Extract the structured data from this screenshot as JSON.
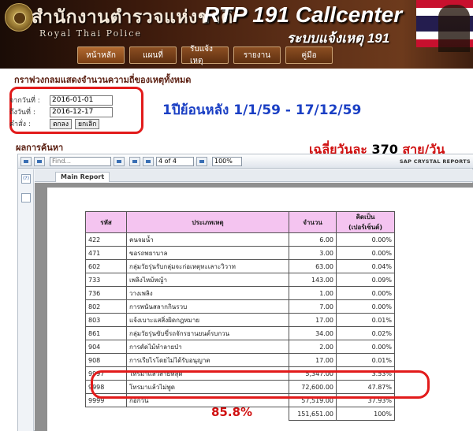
{
  "header": {
    "org_thai": "สำนักงานตำรวจแห่งชาติ",
    "org_english": "Royal Thai Police",
    "app_title": "RTP 191 Callcenter",
    "app_subtitle": "ระบบแจ้งเหตุ 191",
    "nav": [
      {
        "label": "หน้าหลัก",
        "active": true
      },
      {
        "label": "แผนที่",
        "active": false
      },
      {
        "label": "รับแจ้งเหตุ",
        "active": false
      },
      {
        "label": "รายงาน",
        "active": false
      },
      {
        "label": "คู่มือ",
        "active": false
      }
    ]
  },
  "filter": {
    "section_title": "กราฟวงกลมแสดงจำนวนความถี่ของเหตุทั้งหมด",
    "from_label": "จากวันที่ :",
    "from_value": "2016-01-01",
    "to_label": "ถึงวันที่ :",
    "to_value": "2016-12-17",
    "command_label": "คำสั่ง :",
    "ok_label": "ตกลง",
    "cancel_label": "ยกเลิก"
  },
  "annotations": {
    "range_text": "1ปีย้อนหลัง   1/1/59 - 17/12/59",
    "avg_prefix": "เฉลี่ยวันละ ",
    "avg_number": "370",
    "avg_suffix": " สาย/วัน",
    "share_text": "85.8%"
  },
  "results": {
    "title": "ผลการค้นหา"
  },
  "viewer": {
    "find_placeholder": "Find...",
    "page_value": "4 of 4",
    "zoom_value": "100%",
    "brand": "SAP CRYSTAL REPORTS",
    "report_tab": "Main Report",
    "side_buttons": [
      "(?)",
      "tree"
    ]
  },
  "table": {
    "headers": [
      "รหัส",
      "ประเภทเหตุ",
      "จำนวน",
      "คิดเป็น (เปอร์เซ็นต์)"
    ],
    "rows": [
      {
        "code": "422",
        "type": "คนจมน้ำ",
        "count": "6.00",
        "pct": "0.00%"
      },
      {
        "code": "471",
        "type": "ขอรถพยาบาล",
        "count": "3.00",
        "pct": "0.00%"
      },
      {
        "code": "602",
        "type": "กลุ่มวัยรุ่นรับกลุ่มจะก่อเหตุทะเลาะวิวาท",
        "count": "63.00",
        "pct": "0.04%"
      },
      {
        "code": "733",
        "type": "เพลิงไหม้หญ้า",
        "count": "143.00",
        "pct": "0.09%"
      },
      {
        "code": "736",
        "type": "วางเพลิง",
        "count": "1.00",
        "pct": "0.00%"
      },
      {
        "code": "802",
        "type": "การพนันสลากกินรวบ",
        "count": "7.00",
        "pct": "0.00%"
      },
      {
        "code": "803",
        "type": "แจ้งเบาะแสสิ่งผิดกฎหมาย",
        "count": "17.00",
        "pct": "0.01%"
      },
      {
        "code": "861",
        "type": "กลุ่มวัยรุ่นขับขี่รถจักรยานยนต์รบกวน",
        "count": "34.00",
        "pct": "0.02%"
      },
      {
        "code": "904",
        "type": "การตัดไม้ทำลายป่า",
        "count": "2.00",
        "pct": "0.00%"
      },
      {
        "code": "908",
        "type": "การเรียไรโดยไม่ได้รับอนุญาต",
        "count": "17.00",
        "pct": "0.01%"
      },
      {
        "code": "9997",
        "type": "โทรมาแล้วสายหลุด",
        "count": "5,347.00",
        "pct": "3.53%"
      },
      {
        "code": "9998",
        "type": "โทรมาแล้วไม่พูด",
        "count": "72,600.00",
        "pct": "47.87%"
      },
      {
        "code": "9999",
        "type": "ก่อกวน",
        "count": "57,519.00",
        "pct": "37.93%"
      }
    ],
    "total_count": "151,651.00",
    "total_pct": "100%"
  },
  "colors": {
    "annotation_red": "#d01010",
    "annotation_blue": "#1a3fc4",
    "header_brown": "#5a2d16",
    "table_header_pink": "#f4c4f0"
  }
}
